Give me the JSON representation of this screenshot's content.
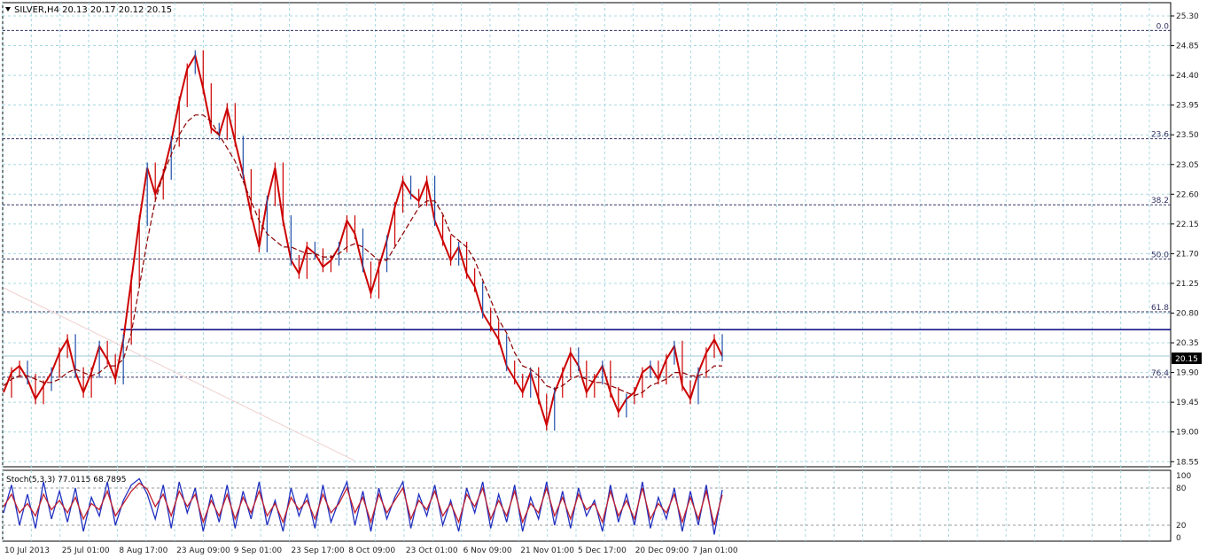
{
  "main_title": "SILVER,H4  20.13 20.17 20.12 20.15",
  "osc_title": "Stoch(5,3,3) 77.0115 68.7895",
  "current_price_label": "20.15",
  "colors": {
    "background": "#ffffff",
    "grid": "#a8d8e0",
    "candle": "#cc0000",
    "candle_alt": "#1f4fa8",
    "ma": "#8b0000",
    "support": "#000080",
    "fib": "#333366",
    "stoch_main": "#2030c0",
    "stoch_signal": "#c02030",
    "axis_text": "#222222"
  },
  "chart_data": [
    {
      "type": "line",
      "title": "SILVER,H4  20.13 20.17 20.12 20.15",
      "ylim": [
        18.4,
        25.4
      ],
      "y_ticks": [
        "25.30",
        "24.85",
        "24.40",
        "23.95",
        "23.50",
        "23.05",
        "22.60",
        "22.15",
        "21.70",
        "21.25",
        "20.80",
        "20.35",
        "19.90",
        "19.45",
        "19.00",
        "18.55"
      ],
      "x_ticks": [
        "10 Jul 2013",
        "25 Jul 01:00",
        "8 Aug 17:00",
        "23 Aug 09:00",
        "9 Sep 01:00",
        "23 Sep 17:00",
        "8 Oct 09:00",
        "23 Oct 01:00",
        "6 Nov 09:00",
        "21 Nov 01:00",
        "5 Dec 17:00",
        "20 Dec 09:00",
        "7 Jan 01:00"
      ],
      "fibonacci_levels": [
        {
          "label": "0.0",
          "price": 25.08
        },
        {
          "label": "23.6",
          "price": 23.44
        },
        {
          "label": "38.2",
          "price": 22.44
        },
        {
          "label": "50.0",
          "price": 21.62
        },
        {
          "label": "61.8",
          "price": 20.82
        },
        {
          "label": "76.4",
          "price": 19.83
        }
      ],
      "support_line": {
        "price": 20.55
      },
      "last_price": 20.15,
      "series": [
        {
          "kind": "price",
          "values": [
            19.6,
            19.9,
            20.0,
            19.8,
            19.5,
            19.7,
            19.9,
            20.2,
            20.4,
            19.9,
            19.6,
            19.9,
            20.3,
            20.1,
            19.8,
            20.4,
            21.3,
            22.2,
            23.0,
            22.6,
            22.9,
            23.4,
            24.0,
            24.5,
            24.7,
            24.2,
            23.6,
            23.5,
            23.9,
            23.4,
            22.9,
            22.3,
            21.8,
            22.5,
            23.0,
            22.2,
            21.6,
            21.4,
            21.8,
            21.7,
            21.5,
            21.6,
            21.8,
            22.2,
            22.0,
            21.5,
            21.1,
            21.5,
            21.9,
            22.4,
            22.8,
            22.6,
            22.5,
            22.8,
            22.2,
            21.9,
            21.6,
            21.8,
            21.4,
            21.2,
            20.8,
            20.6,
            20.4,
            20.0,
            19.8,
            19.6,
            19.9,
            19.5,
            19.1,
            19.6,
            19.9,
            20.2,
            20.0,
            19.6,
            19.8,
            20.0,
            19.6,
            19.3,
            19.5,
            19.6,
            19.9,
            20.0,
            19.8,
            20.1,
            20.3,
            19.7,
            19.5,
            19.9,
            20.2,
            20.4,
            20.15
          ]
        },
        {
          "kind": "moving_average",
          "values": [
            19.7,
            19.8,
            19.85,
            19.85,
            19.8,
            19.75,
            19.75,
            19.8,
            19.9,
            19.95,
            19.9,
            19.85,
            19.9,
            20.0,
            20.0,
            20.1,
            20.5,
            21.2,
            21.9,
            22.5,
            22.9,
            23.2,
            23.5,
            23.7,
            23.8,
            23.8,
            23.7,
            23.5,
            23.3,
            23.1,
            22.8,
            22.5,
            22.2,
            22.0,
            21.9,
            21.8,
            21.8,
            21.75,
            21.7,
            21.7,
            21.65,
            21.65,
            21.7,
            21.8,
            21.85,
            21.8,
            21.7,
            21.6,
            21.6,
            21.8,
            22.0,
            22.2,
            22.4,
            22.5,
            22.5,
            22.3,
            22.0,
            21.9,
            21.8,
            21.6,
            21.3,
            21.0,
            20.7,
            20.5,
            20.2,
            20.0,
            19.95,
            19.85,
            19.7,
            19.65,
            19.7,
            19.8,
            19.85,
            19.8,
            19.75,
            19.75,
            19.7,
            19.65,
            19.6,
            19.55,
            19.6,
            19.7,
            19.75,
            19.8,
            19.9,
            19.9,
            19.85,
            19.85,
            19.9,
            20.0,
            20.0
          ]
        }
      ]
    },
    {
      "type": "line",
      "title": "Stoch(5,3,3) 77.0115 68.7895",
      "ylim": [
        0,
        100
      ],
      "y_ticks": [
        "100",
        "80",
        "20",
        "0"
      ],
      "levels": [
        80,
        20
      ],
      "series": [
        {
          "name": "main",
          "values": [
            40,
            85,
            20,
            70,
            15,
            90,
            30,
            75,
            25,
            80,
            10,
            65,
            35,
            90,
            20,
            60,
            85,
            95,
            70,
            30,
            85,
            15,
            90,
            40,
            80,
            10,
            70,
            25,
            85,
            15,
            75,
            30,
            90,
            20,
            60,
            10,
            80,
            35,
            70,
            15,
            85,
            25,
            60,
            90,
            20,
            75,
            10,
            80,
            30,
            65,
            90,
            15,
            70,
            35,
            85,
            20,
            60,
            10,
            80,
            40,
            90,
            15,
            70,
            25,
            85,
            10,
            65,
            30,
            90,
            20,
            75,
            15,
            80,
            35,
            60,
            10,
            85,
            25,
            70,
            20,
            90,
            15,
            65,
            30,
            80,
            10,
            75,
            20,
            85,
            5,
            77
          ]
        },
        {
          "name": "signal",
          "values": [
            50,
            70,
            40,
            55,
            35,
            70,
            45,
            60,
            40,
            65,
            30,
            55,
            45,
            75,
            35,
            55,
            75,
            88,
            78,
            50,
            70,
            35,
            75,
            50,
            70,
            25,
            60,
            35,
            70,
            30,
            65,
            40,
            75,
            35,
            55,
            25,
            65,
            45,
            60,
            30,
            70,
            40,
            55,
            80,
            40,
            65,
            25,
            70,
            40,
            60,
            80,
            30,
            60,
            45,
            75,
            35,
            55,
            25,
            70,
            50,
            80,
            30,
            60,
            35,
            75,
            25,
            55,
            40,
            80,
            35,
            65,
            30,
            70,
            45,
            55,
            25,
            75,
            35,
            60,
            30,
            80,
            30,
            55,
            40,
            70,
            25,
            65,
            30,
            75,
            20,
            69
          ]
        }
      ]
    }
  ]
}
